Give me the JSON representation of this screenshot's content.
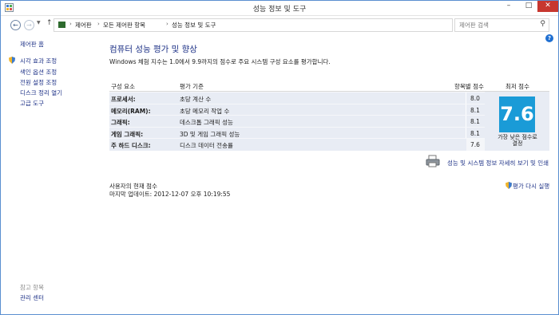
{
  "window": {
    "title": "성능 정보 및 도구",
    "minimize": "–",
    "maximize": "□",
    "close": "✕"
  },
  "nav": {
    "back": "←",
    "forward": "→",
    "dropdown": "▼",
    "up": "↑",
    "breadcrumbs": [
      "제어판",
      "모든 제어판 항목",
      "성능 정보 및 도구"
    ],
    "separator": "›",
    "addr_dropdown": "▾",
    "refresh": "↻",
    "search_placeholder": "제어판 검색",
    "search_icon": "⚲"
  },
  "sidebar": {
    "home": "제어판 홈",
    "links": [
      "시각 효과 조정",
      "색인 옵션 조정",
      "전원 설정 조정",
      "디스크 정리 열기",
      "고급 도구"
    ],
    "see_also_title": "참고 항목",
    "see_also_link": "관리 센터"
  },
  "main": {
    "help": "?",
    "heading": "컴퓨터 성능 평가 및 향상",
    "intro": "Windows 체험 지수는 1.0에서 9.9까지의 점수로 주요 시스템 구성 요소를 평가합니다.",
    "columns": {
      "component": "구성 요소",
      "rating": "평가 기준",
      "subscore": "항목별 점수",
      "base": "최저 점수"
    },
    "rows": [
      {
        "component": "프로세서:",
        "rating": "초당 계산 수",
        "score": "8.0"
      },
      {
        "component": "메모리(RAM):",
        "rating": "초당 메모리 작업 수",
        "score": "8.1"
      },
      {
        "component": "그래픽:",
        "rating": "데스크톱 그래픽 성능",
        "score": "8.1"
      },
      {
        "component": "게임 그래픽:",
        "rating": "3D 및 게임 그래픽 성능",
        "score": "8.1"
      },
      {
        "component": "주 하드 디스크:",
        "rating": "디스크 데이터 전송률",
        "score": "7.6"
      }
    ],
    "base_score": "7.6",
    "base_caption": "가장 낮은 점수로 결정",
    "print_link": "성능 및 시스템 정보 자세히 보기 및 인쇄",
    "current_title": "사용자의 현재 점수",
    "last_update": "마지막 업데이트: 2012-12-07 오후 10:19:55",
    "rerun": "평가 다시 실행"
  },
  "colors": {
    "score_tile": "#1a9bd7",
    "link": "#1e3287",
    "table_bg": "#e8ecf4",
    "close_button": "#c7372f"
  }
}
